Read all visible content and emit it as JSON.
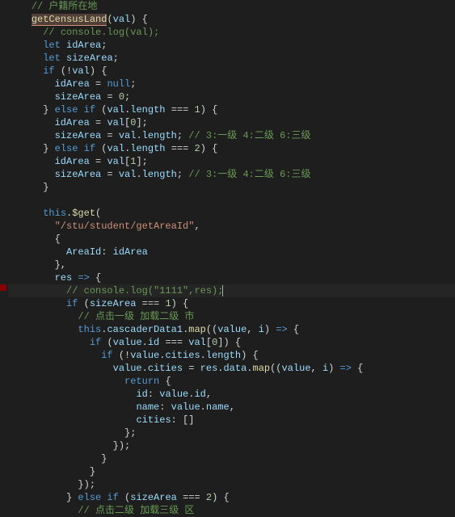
{
  "code": {
    "l1_comment": "// 户籍所在地",
    "l2_fn": "getCensusLand",
    "l2_param": "val",
    "l3_comment": "// console.log(val);",
    "l4_let": "let",
    "l4_var": "idArea",
    "l5_let": "let",
    "l5_var": "sizeArea",
    "l6_if": "if",
    "l6_expr": "!val",
    "l7_var": "idArea",
    "l7_null": "null",
    "l8_var": "sizeArea",
    "l8_val": "0",
    "l9_else": "else if",
    "l9_cond_a": "val",
    "l9_cond_b": "length",
    "l9_cond_val": "1",
    "l10_var": "idArea",
    "l10_rhs_a": "val",
    "l10_idx": "0",
    "l11_var": "sizeArea",
    "l11_rhs_a": "val",
    "l11_rhs_b": "length",
    "l11_comment": "// 3:一级 4:二级 6:三级",
    "l12_else": "else if",
    "l12_cond_a": "val",
    "l12_cond_b": "length",
    "l12_cond_val": "2",
    "l13_var": "idArea",
    "l13_rhs_a": "val",
    "l13_idx": "1",
    "l14_var": "sizeArea",
    "l14_rhs_a": "val",
    "l14_rhs_b": "length",
    "l14_comment": "// 3:一级 4:二级 6:三级",
    "l17_this": "this",
    "l17_fn": "$get",
    "l18_str": "\"/stu/student/getAreaId\"",
    "l20_key": "AreaId",
    "l20_val": "idArea",
    "l22_var": "res",
    "l23_comment": "// console.log(\"1111\",res);",
    "l24_if": "if",
    "l24_var": "sizeArea",
    "l24_val": "1",
    "l25_comment": "// 点击一级 加载二级 市",
    "l26_this": "this",
    "l26_prop": "cascaderData1",
    "l26_map": "map",
    "l26_p1": "value",
    "l26_p2": "i",
    "l27_if": "if",
    "l27_a": "value",
    "l27_b": "id",
    "l27_c": "val",
    "l27_idx": "0",
    "l28_if": "if",
    "l28_a": "value",
    "l28_b": "cities",
    "l28_c": "length",
    "l29_a": "value",
    "l29_b": "cities",
    "l29_c": "res",
    "l29_d": "data",
    "l29_map": "map",
    "l29_p1": "value",
    "l29_p2": "i",
    "l30_ret": "return",
    "l31_k": "id",
    "l31_a": "value",
    "l31_b": "id",
    "l32_k": "name",
    "l32_a": "value",
    "l32_b": "name",
    "l33_k": "cities",
    "l38_else": "else if",
    "l38_var": "sizeArea",
    "l38_val": "2",
    "l39_comment": "// 点击二级 加载三级 区"
  }
}
